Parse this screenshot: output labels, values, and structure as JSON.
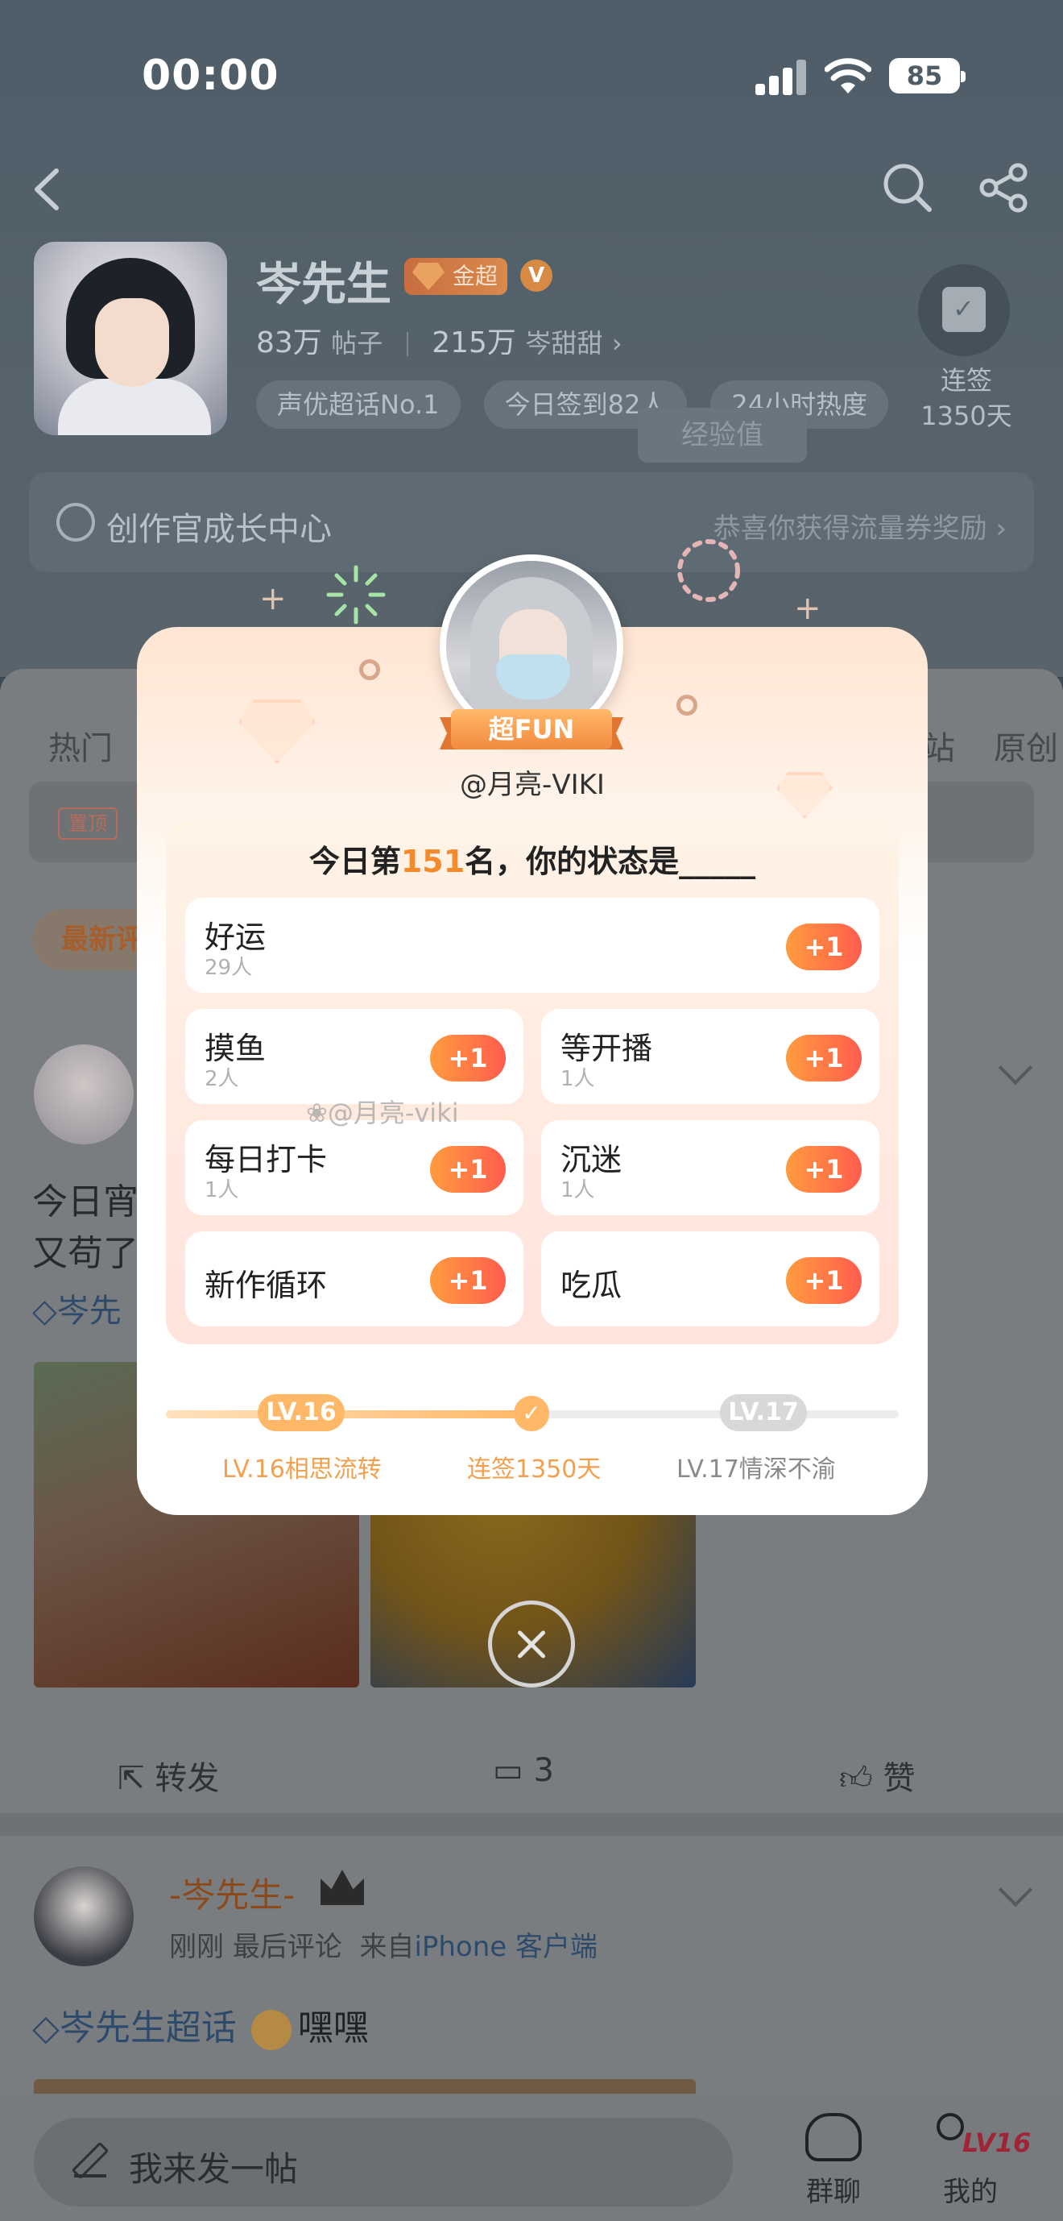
{
  "status_bar": {
    "time": "00:00",
    "battery": "85"
  },
  "profile": {
    "name": "岑先生",
    "badge": "金超",
    "posts_count": "83万",
    "posts_label": "帖子",
    "fans_count": "215万",
    "fans_label": "岑甜甜",
    "chips": [
      "声优超话No.1",
      "今日签到82人",
      "24小时热度"
    ],
    "checkin_label": "连签",
    "checkin_days": "1350天",
    "exp_tip": "经验值"
  },
  "growth_center": {
    "label": "创作官成长中心",
    "reward": "恭喜你获得流量券奖励"
  },
  "tabs": [
    "热门",
    "站",
    "原创"
  ],
  "pinned_tag": "置顶",
  "sort_label": "最新评",
  "post1": {
    "text_lines": [
      "今日宵",
      "又苟了"
    ],
    "topic": "岑先",
    "actions": {
      "repost": "转发",
      "comments": "3",
      "like": "赞"
    }
  },
  "post2": {
    "author": "-岑先生-",
    "time": "刚刚",
    "meta": "最后评论",
    "source_prefix": "来自",
    "source": "iPhone 客户端",
    "topic": "岑先生超话",
    "text": "嘿嘿"
  },
  "bottom_bar": {
    "compose": "我来发一帖",
    "group_chat": "群聊",
    "me": "我的",
    "me_level": "LV16"
  },
  "modal": {
    "title_badge": "超FUN",
    "user": "@月亮-VIKI",
    "question_prefix": "今日第",
    "rank": "151",
    "question_suffix": "名，你的状态是_____",
    "options": [
      {
        "name": "好运",
        "count": "29人"
      },
      {
        "name": "摸鱼",
        "count": "2人"
      },
      {
        "name": "等开播",
        "count": "1人"
      },
      {
        "name": "每日打卡",
        "count": "1人"
      },
      {
        "name": "沉迷",
        "count": "1人"
      },
      {
        "name": "新作循环",
        "count": ""
      },
      {
        "name": "吃瓜",
        "count": ""
      }
    ],
    "plus_label": "+1",
    "watermark": "@月亮-viki",
    "progress": {
      "current_level": "LV.16",
      "next_level": "LV.17",
      "current_title": "LV.16相思流转",
      "streak": "连签1350天",
      "next_title": "LV.17情深不渝",
      "fraction": 0.5
    }
  },
  "colors": {
    "accent_orange": "#f58a2a",
    "plus_gradient_start": "#ff9b3e",
    "plus_gradient_end": "#ff5d4e",
    "overlay_bg": "#4e5d68"
  }
}
